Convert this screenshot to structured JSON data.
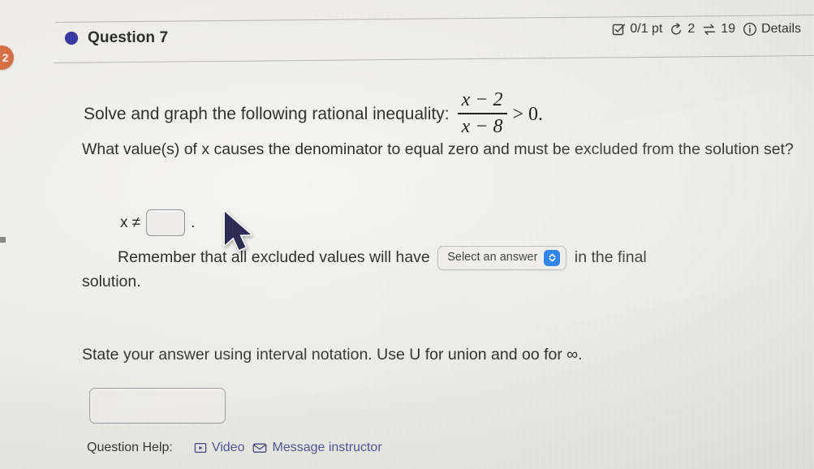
{
  "badge": {
    "label": "2"
  },
  "question": {
    "title": "Question 7",
    "meta": {
      "score": "0/1 pt",
      "attempts": "2",
      "exchanges": "19",
      "details_label": "Details",
      "score_icon": "checkbox-icon",
      "attempts_icon": "undo-arrow-icon",
      "exchanges_icon": "exchange-arrows-icon",
      "details_icon": "info-circle-icon"
    }
  },
  "body": {
    "prompt_intro": "Solve and graph the following rational inequality:",
    "expression": {
      "numerator": "x − 2",
      "denominator": "x − 8",
      "relation": "> 0."
    },
    "prompt_denominator": "What value(s) of x causes the denominator to equal zero and must be excluded from the solution set?",
    "x_not_equal_label": "x ≠",
    "x_not_equal_value": "",
    "x_not_equal_period": ".",
    "remember_before": "Remember that all excluded values will have",
    "select_answer_label": "Select an answer",
    "select_answer_value": "",
    "remember_after": "in the final",
    "remember_tail": "solution.",
    "interval_instruction": "State your answer using interval notation. Use U for union and oo for ∞.",
    "final_answer_value": "",
    "final_answer_placeholder": ""
  },
  "help": {
    "label": "Question Help:",
    "video_label": "Video",
    "video_icon": "play-box-icon",
    "message_label": "Message instructor",
    "message_icon": "envelope-icon"
  },
  "colors": {
    "background": "#e8e8e3",
    "bullet": "#2d2da0",
    "badge": "#d4683c",
    "stepper": "#1675e8",
    "link": "#4a4a8f"
  }
}
